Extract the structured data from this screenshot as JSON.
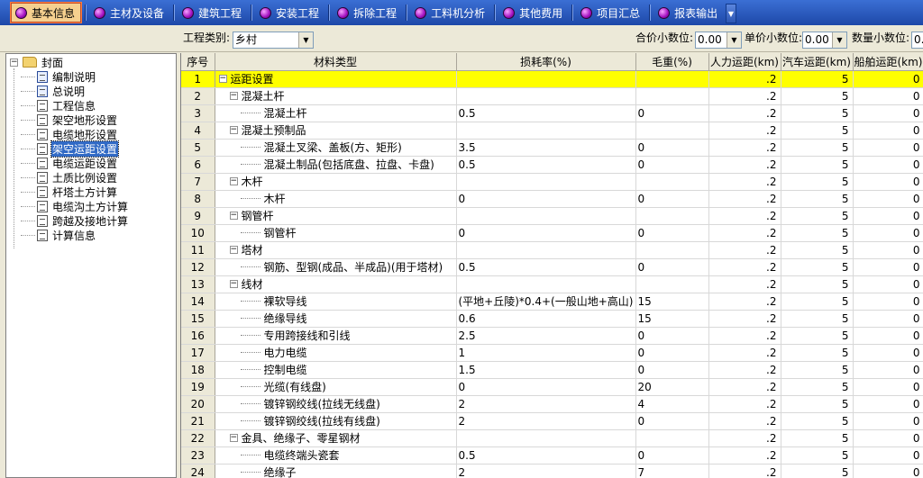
{
  "toolbar": {
    "tabs": [
      {
        "label": "基本信息",
        "active": true
      },
      {
        "label": "主材及设备"
      },
      {
        "label": "建筑工程"
      },
      {
        "label": "安装工程"
      },
      {
        "label": "拆除工程"
      },
      {
        "label": "工料机分析"
      },
      {
        "label": "其他费用"
      },
      {
        "label": "项目汇总"
      },
      {
        "label": "报表输出"
      }
    ]
  },
  "filters": {
    "project_type_label": "工程类别:",
    "project_type_value": "乡村",
    "total_decimals_label": "合价小数位:",
    "total_decimals_value": "0.00",
    "unit_decimals_label": "单价小数位:",
    "unit_decimals_value": "0.00",
    "qty_decimals_label": "数量小数位:",
    "qty_decimals_value": "0.0"
  },
  "tree": {
    "root": "封面",
    "items": [
      {
        "label": "编制说明",
        "icon": "word-doc-icon"
      },
      {
        "label": "总说明",
        "icon": "word-doc-icon"
      },
      {
        "label": "工程信息",
        "icon": "doc-icon"
      },
      {
        "label": "架空地形设置",
        "icon": "doc-icon"
      },
      {
        "label": "电缆地形设置",
        "icon": "doc-icon"
      },
      {
        "label": "架空运距设置",
        "icon": "doc-icon",
        "selected": true
      },
      {
        "label": "电缆运距设置",
        "icon": "doc-icon"
      },
      {
        "label": "土质比例设置",
        "icon": "doc-icon"
      },
      {
        "label": "杆塔土方计算",
        "icon": "doc-icon"
      },
      {
        "label": "电缆沟土方计算",
        "icon": "doc-icon"
      },
      {
        "label": "跨越及接地计算",
        "icon": "doc-icon"
      },
      {
        "label": "计算信息",
        "icon": "doc-icon"
      }
    ]
  },
  "grid": {
    "columns": [
      "序号",
      "材料类型",
      "损耗率(%)",
      "毛重(%)",
      "人力运距(km)",
      "汽车运距(km)",
      "船舶运距(km)"
    ],
    "rows": [
      {
        "seq": "1",
        "level": 0,
        "exp": "−",
        "name": "运距设置",
        "loss": "",
        "weight": "",
        "manual": ".2",
        "truck": "5",
        "ship": "0",
        "highlight": true
      },
      {
        "seq": "2",
        "level": 1,
        "exp": "−",
        "name": "混凝土杆",
        "loss": "",
        "weight": "",
        "manual": ".2",
        "truck": "5",
        "ship": "0"
      },
      {
        "seq": "3",
        "level": 2,
        "name": "混凝土杆",
        "loss": "0.5",
        "weight": "0",
        "manual": ".2",
        "truck": "5",
        "ship": "0"
      },
      {
        "seq": "4",
        "level": 1,
        "exp": "−",
        "name": "混凝土预制品",
        "loss": "",
        "weight": "",
        "manual": ".2",
        "truck": "5",
        "ship": "0"
      },
      {
        "seq": "5",
        "level": 2,
        "name": "混凝土叉梁、盖板(方、矩形)",
        "loss": "3.5",
        "weight": "0",
        "manual": ".2",
        "truck": "5",
        "ship": "0"
      },
      {
        "seq": "6",
        "level": 2,
        "name": "混凝土制品(包括底盘、拉盘、卡盘)",
        "loss": "0.5",
        "weight": "0",
        "manual": ".2",
        "truck": "5",
        "ship": "0"
      },
      {
        "seq": "7",
        "level": 1,
        "exp": "−",
        "name": "木杆",
        "loss": "",
        "weight": "",
        "manual": ".2",
        "truck": "5",
        "ship": "0"
      },
      {
        "seq": "8",
        "level": 2,
        "name": "木杆",
        "loss": "0",
        "weight": "0",
        "manual": ".2",
        "truck": "5",
        "ship": "0"
      },
      {
        "seq": "9",
        "level": 1,
        "exp": "−",
        "name": "钢管杆",
        "loss": "",
        "weight": "",
        "manual": ".2",
        "truck": "5",
        "ship": "0"
      },
      {
        "seq": "10",
        "level": 2,
        "name": "钢管杆",
        "loss": "0",
        "weight": "0",
        "manual": ".2",
        "truck": "5",
        "ship": "0"
      },
      {
        "seq": "11",
        "level": 1,
        "exp": "−",
        "name": "塔材",
        "loss": "",
        "weight": "",
        "manual": ".2",
        "truck": "5",
        "ship": "0"
      },
      {
        "seq": "12",
        "level": 2,
        "name": "钢筋、型钢(成品、半成品)(用于塔材)",
        "loss": "0.5",
        "weight": "0",
        "manual": ".2",
        "truck": "5",
        "ship": "0"
      },
      {
        "seq": "13",
        "level": 1,
        "exp": "−",
        "name": "线材",
        "loss": "",
        "weight": "",
        "manual": ".2",
        "truck": "5",
        "ship": "0"
      },
      {
        "seq": "14",
        "level": 2,
        "name": "裸软导线",
        "loss": "(平地+丘陵)*0.4+(一般山地+高山)",
        "weight": "15",
        "manual": ".2",
        "truck": "5",
        "ship": "0"
      },
      {
        "seq": "15",
        "level": 2,
        "name": "绝缘导线",
        "loss": "0.6",
        "weight": "15",
        "manual": ".2",
        "truck": "5",
        "ship": "0"
      },
      {
        "seq": "16",
        "level": 2,
        "name": "专用跨接线和引线",
        "loss": "2.5",
        "weight": "0",
        "manual": ".2",
        "truck": "5",
        "ship": "0"
      },
      {
        "seq": "17",
        "level": 2,
        "name": "电力电缆",
        "loss": "1",
        "weight": "0",
        "manual": ".2",
        "truck": "5",
        "ship": "0"
      },
      {
        "seq": "18",
        "level": 2,
        "name": "控制电缆",
        "loss": "1.5",
        "weight": "0",
        "manual": ".2",
        "truck": "5",
        "ship": "0"
      },
      {
        "seq": "19",
        "level": 2,
        "name": "光缆(有线盘)",
        "loss": "0",
        "weight": "20",
        "manual": ".2",
        "truck": "5",
        "ship": "0"
      },
      {
        "seq": "20",
        "level": 2,
        "name": "镀锌钢绞线(拉线无线盘)",
        "loss": "2",
        "weight": "4",
        "manual": ".2",
        "truck": "5",
        "ship": "0"
      },
      {
        "seq": "21",
        "level": 2,
        "name": "镀锌钢绞线(拉线有线盘)",
        "loss": "2",
        "weight": "0",
        "manual": ".2",
        "truck": "5",
        "ship": "0"
      },
      {
        "seq": "22",
        "level": 1,
        "exp": "−",
        "name": "金具、绝缘子、零星钢材",
        "loss": "",
        "weight": "",
        "manual": ".2",
        "truck": "5",
        "ship": "0"
      },
      {
        "seq": "23",
        "level": 2,
        "name": "电缆终端头瓷套",
        "loss": "0.5",
        "weight": "0",
        "manual": ".2",
        "truck": "5",
        "ship": "0"
      },
      {
        "seq": "24",
        "level": 2,
        "name": "绝缘子",
        "loss": "2",
        "weight": "7",
        "manual": ".2",
        "truck": "5",
        "ship": "0"
      }
    ]
  }
}
